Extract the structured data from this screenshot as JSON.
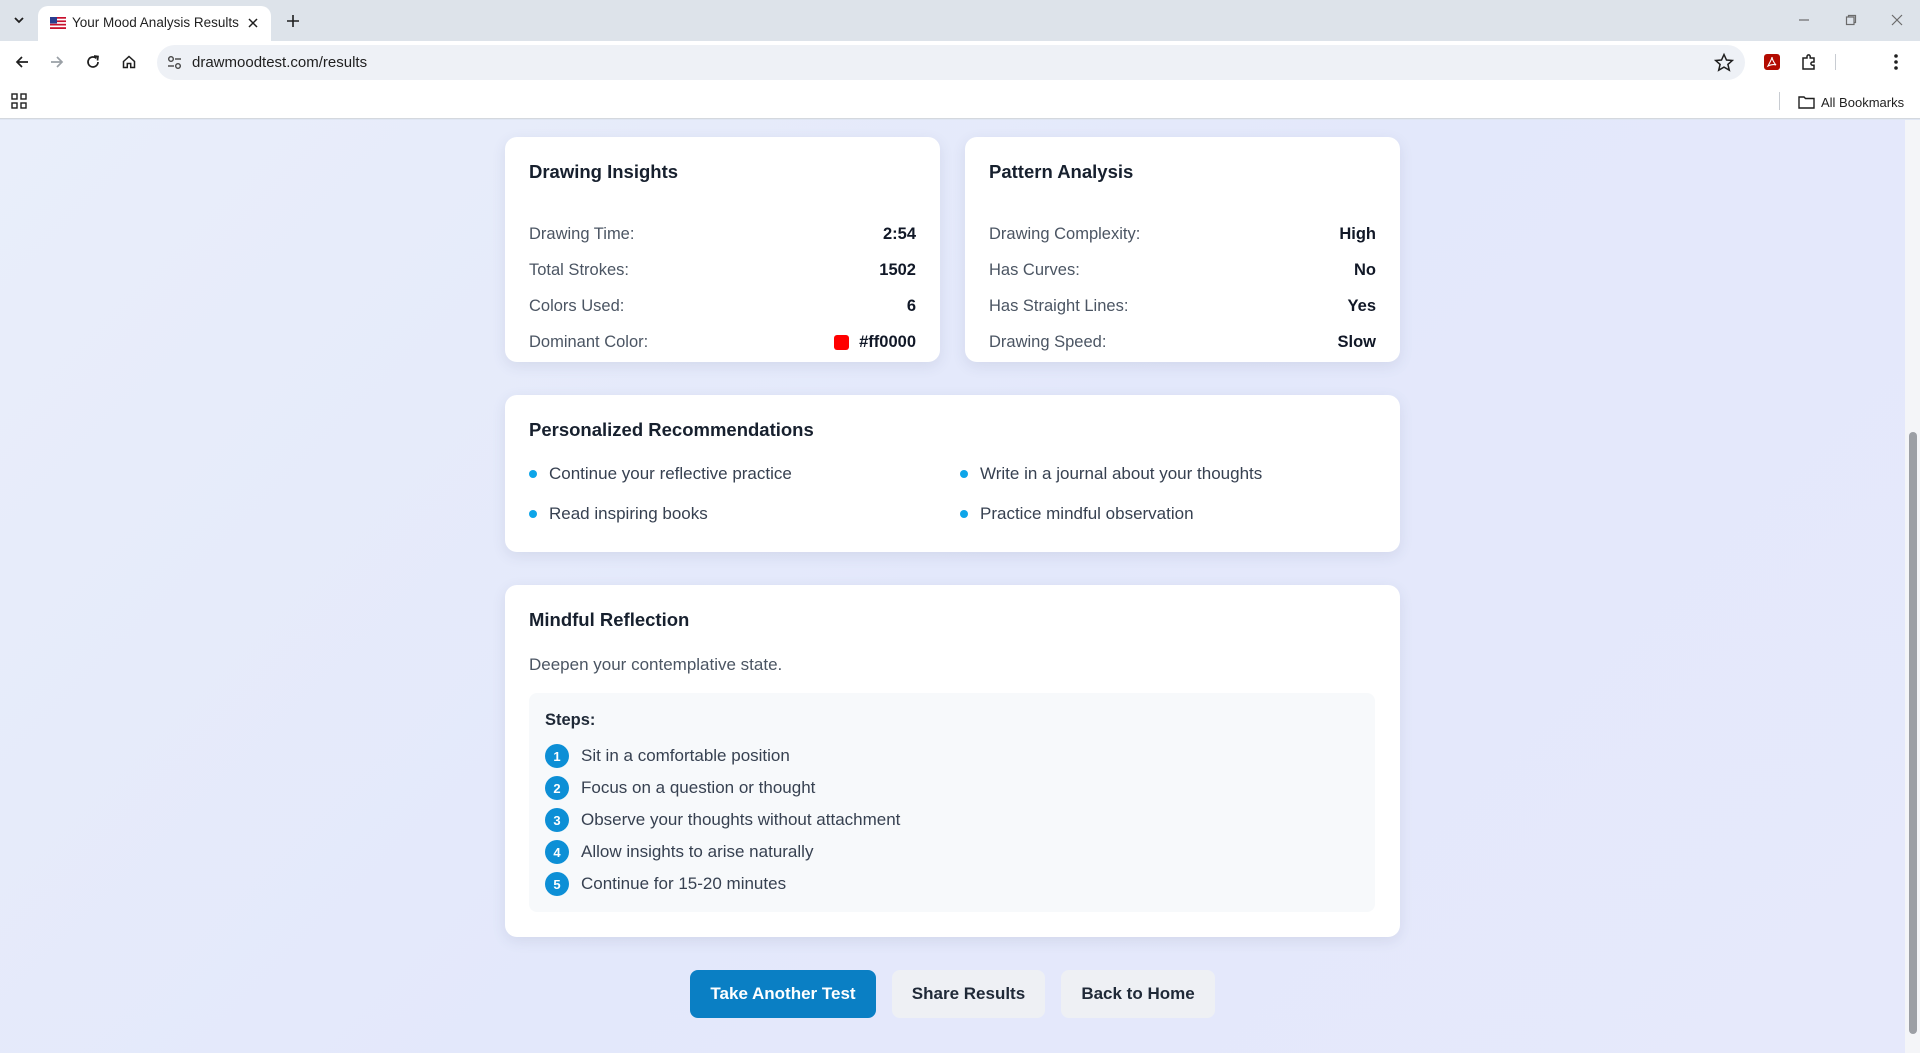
{
  "browser": {
    "tab_title": "Your Mood Analysis Results |",
    "url": "drawmoodtest.com/results",
    "all_bookmarks_label": "All Bookmarks"
  },
  "drawing_insights": {
    "title": "Drawing Insights",
    "rows": [
      {
        "label": "Drawing Time:",
        "value": "2:54"
      },
      {
        "label": "Total Strokes:",
        "value": "1502"
      },
      {
        "label": "Colors Used:",
        "value": "6"
      },
      {
        "label": "Dominant Color:",
        "value": "#ff0000"
      }
    ],
    "dominant_color": "#ff0000"
  },
  "pattern_analysis": {
    "title": "Pattern Analysis",
    "rows": [
      {
        "label": "Drawing Complexity:",
        "value": "High"
      },
      {
        "label": "Has Curves:",
        "value": "No"
      },
      {
        "label": "Has Straight Lines:",
        "value": "Yes"
      },
      {
        "label": "Drawing Speed:",
        "value": "Slow"
      }
    ]
  },
  "recommendations": {
    "title": "Personalized Recommendations",
    "items": [
      "Continue your reflective practice",
      "Write in a journal about your thoughts",
      "Read inspiring books",
      "Practice mindful observation"
    ]
  },
  "reflection": {
    "title": "Mindful Reflection",
    "subtitle": "Deepen your contemplative state.",
    "steps_title": "Steps:",
    "steps": [
      {
        "num": "1",
        "text": "Sit in a comfortable position"
      },
      {
        "num": "2",
        "text": "Focus on a question or thought"
      },
      {
        "num": "3",
        "text": "Observe your thoughts without attachment"
      },
      {
        "num": "4",
        "text": "Allow insights to arise naturally"
      },
      {
        "num": "5",
        "text": "Continue for 15-20 minutes"
      }
    ]
  },
  "actions": {
    "take_test": "Take Another Test",
    "share": "Share Results",
    "home": "Back to Home"
  },
  "colors": {
    "accent": "#0a7fc4",
    "bullet": "#0ea5e9"
  }
}
